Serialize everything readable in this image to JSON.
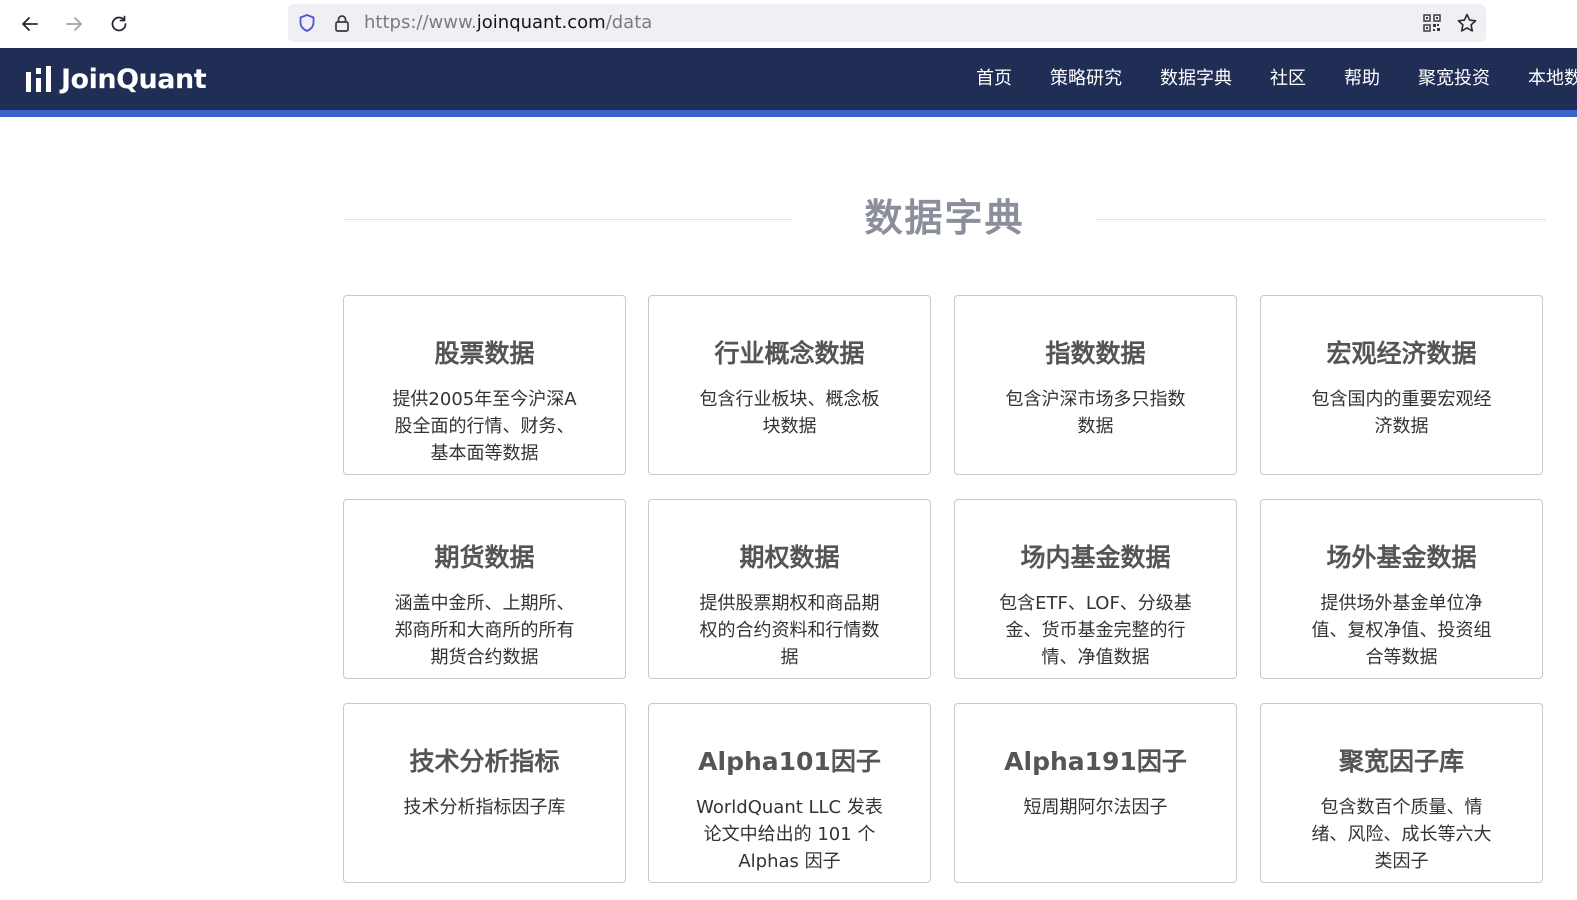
{
  "browser": {
    "url_scheme": "https://www.",
    "url_host": "joinquant.com",
    "url_path": "/data"
  },
  "site": {
    "logo_text": "JoinQuant",
    "nav": [
      "首页",
      "策略研究",
      "数据字典",
      "社区",
      "帮助",
      "聚宽投资",
      "本地数据"
    ]
  },
  "page": {
    "title": "数据字典"
  },
  "cards": [
    {
      "title": "股票数据",
      "desc": "提供2005年至今沪深A股全面的行情、财务、基本面等数据"
    },
    {
      "title": "行业概念数据",
      "desc": "包含行业板块、概念板块数据"
    },
    {
      "title": "指数数据",
      "desc": "包含沪深市场多只指数数据"
    },
    {
      "title": "宏观经济数据",
      "desc": "包含国内的重要宏观经济数据"
    },
    {
      "title": "期货数据",
      "desc": "涵盖中金所、上期所、郑商所和大商所的所有期货合约数据"
    },
    {
      "title": "期权数据",
      "desc": "提供股票期权和商品期权的合约资料和行情数据"
    },
    {
      "title": "场内基金数据",
      "desc": "包含ETF、LOF、分级基金、货币基金完整的行情、净值数据"
    },
    {
      "title": "场外基金数据",
      "desc": "提供场外基金单位净值、复权净值、投资组合等数据"
    },
    {
      "title": "技术分析指标",
      "desc": "技术分析指标因子库"
    },
    {
      "title": "Alpha101因子",
      "desc": "WorldQuant LLC 发表论文中给出的 101 个 Alphas 因子"
    },
    {
      "title": "Alpha191因子",
      "desc": "短周期阿尔法因子"
    },
    {
      "title": "聚宽因子库",
      "desc": "包含数百个质量、情绪、风险、成长等六大类因子"
    }
  ],
  "colors": {
    "header_bg": "#202e56",
    "header_accent": "#3a64c8",
    "title_gray": "#8a8f9a"
  }
}
